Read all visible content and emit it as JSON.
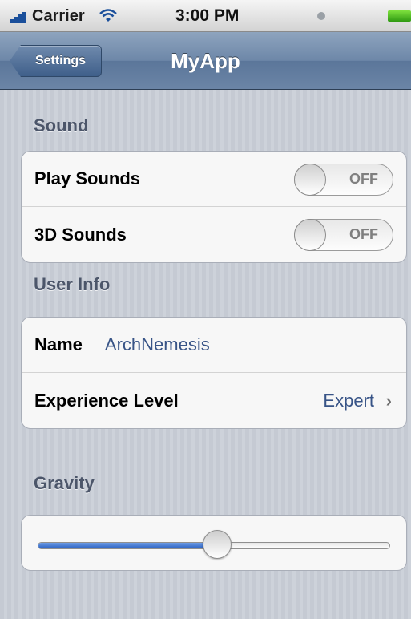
{
  "status_bar": {
    "carrier": "Carrier",
    "time": "3:00 PM",
    "icons": [
      "signal-icon",
      "wifi-icon",
      "alarm-icon",
      "battery-icon"
    ]
  },
  "nav": {
    "back_label": "Settings",
    "title": "MyApp"
  },
  "sound": {
    "header": "Sound",
    "play_sounds": {
      "label": "Play Sounds",
      "state": "OFF"
    },
    "sounds_3d": {
      "label": "3D Sounds",
      "state": "OFF"
    }
  },
  "user_info": {
    "header": "User Info",
    "name_label": "Name",
    "name_value": "ArchNemesis",
    "experience_label": "Experience Level",
    "experience_value": "Expert",
    "chevron": "›"
  },
  "gravity": {
    "header": "Gravity",
    "value": 0.51
  },
  "colors": {
    "nav_bar": "#6d87a8",
    "value_text": "#385487",
    "slider_fill": "#2b62c3"
  }
}
